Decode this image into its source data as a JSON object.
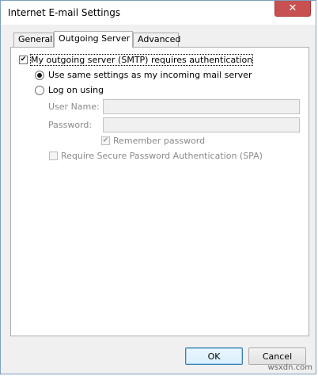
{
  "window": {
    "title": "Internet E-mail Settings",
    "close_glyph": "✕"
  },
  "tabs": [
    {
      "label": "General",
      "active": false
    },
    {
      "label": "Outgoing Server",
      "active": true
    },
    {
      "label": "Advanced",
      "active": false
    }
  ],
  "smtp_auth": {
    "label": "My outgoing server (SMTP) requires authentication",
    "checked": true,
    "check_glyph": "✔"
  },
  "same_settings": {
    "label": "Use same settings as my incoming mail server",
    "selected": true
  },
  "log_on_using": {
    "label": "Log on using",
    "selected": false
  },
  "user_name": {
    "label": "User Name:",
    "value": ""
  },
  "password": {
    "label": "Password:",
    "value": ""
  },
  "remember_password": {
    "label": "Remember password",
    "checked": true,
    "check_glyph": "✔"
  },
  "require_spa": {
    "label": "Require Secure Password Authentication (SPA)",
    "checked": false
  },
  "buttons": {
    "ok": "OK",
    "cancel": "Cancel"
  },
  "watermark": "wsxdn.com"
}
